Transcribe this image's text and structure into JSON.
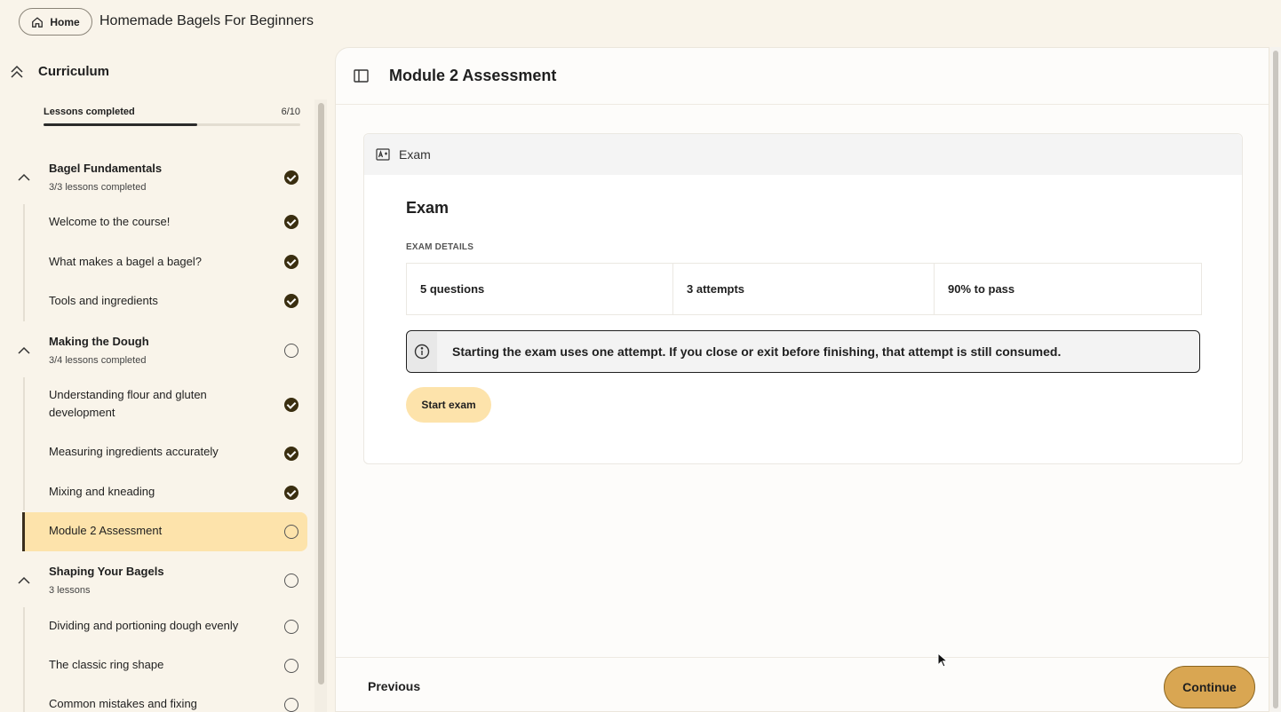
{
  "topbar": {
    "home_label": "Home",
    "course_title": "Homemade Bagels For Beginners"
  },
  "sidebar": {
    "curriculum_label": "Curriculum",
    "progress": {
      "label": "Lessons completed",
      "count_text": "6/10",
      "completed": 6,
      "total": 10
    },
    "modules": [
      {
        "title": "Bagel Fundamentals",
        "subtitle": "3/3 lessons completed",
        "status": "done",
        "lessons": [
          {
            "label": "Welcome to the course!",
            "status": "done"
          },
          {
            "label": "What makes a bagel a bagel?",
            "status": "done"
          },
          {
            "label": "Tools and ingredients",
            "status": "done"
          }
        ]
      },
      {
        "title": "Making the Dough",
        "subtitle": "3/4 lessons completed",
        "status": "todo",
        "lessons": [
          {
            "label": "Understanding flour and gluten development",
            "status": "done"
          },
          {
            "label": "Measuring ingredients accurately",
            "status": "done"
          },
          {
            "label": "Mixing and kneading",
            "status": "done"
          },
          {
            "label": "Module 2 Assessment",
            "status": "todo",
            "active": true
          }
        ]
      },
      {
        "title": "Shaping Your Bagels",
        "subtitle": "3 lessons",
        "status": "todo",
        "lessons": [
          {
            "label": "Dividing and portioning dough evenly",
            "status": "todo"
          },
          {
            "label": "The classic ring shape",
            "status": "todo"
          },
          {
            "label": "Common mistakes and fixing",
            "status": "todo"
          }
        ]
      }
    ]
  },
  "main": {
    "title": "Module 2 Assessment",
    "card_label": "Exam",
    "exam_title": "Exam",
    "details_label": "EXAM DETAILS",
    "details": [
      "5 questions",
      "3 attempts",
      "90% to pass"
    ],
    "notice": "Starting the exam uses one attempt. If you close or exit before finishing, that attempt is still consumed.",
    "start_label": "Start exam"
  },
  "footer": {
    "previous_label": "Previous",
    "continue_label": "Continue"
  },
  "icons": {
    "home": "home-icon",
    "curriculum_toggle": "double-chevron-up-icon",
    "module_toggle": "chevron-up-icon",
    "panel_toggle": "sidebar-panel-icon",
    "exam": "exam-grade-icon",
    "info": "info-icon",
    "done": "check-circle-icon",
    "todo": "empty-circle-icon"
  },
  "colors": {
    "page_background": "#f9f4ea",
    "active_lesson": "#fde3ab",
    "start_button": "#fde3ab",
    "continue_button": "#d9a652",
    "done_status": "#3a2e10"
  }
}
